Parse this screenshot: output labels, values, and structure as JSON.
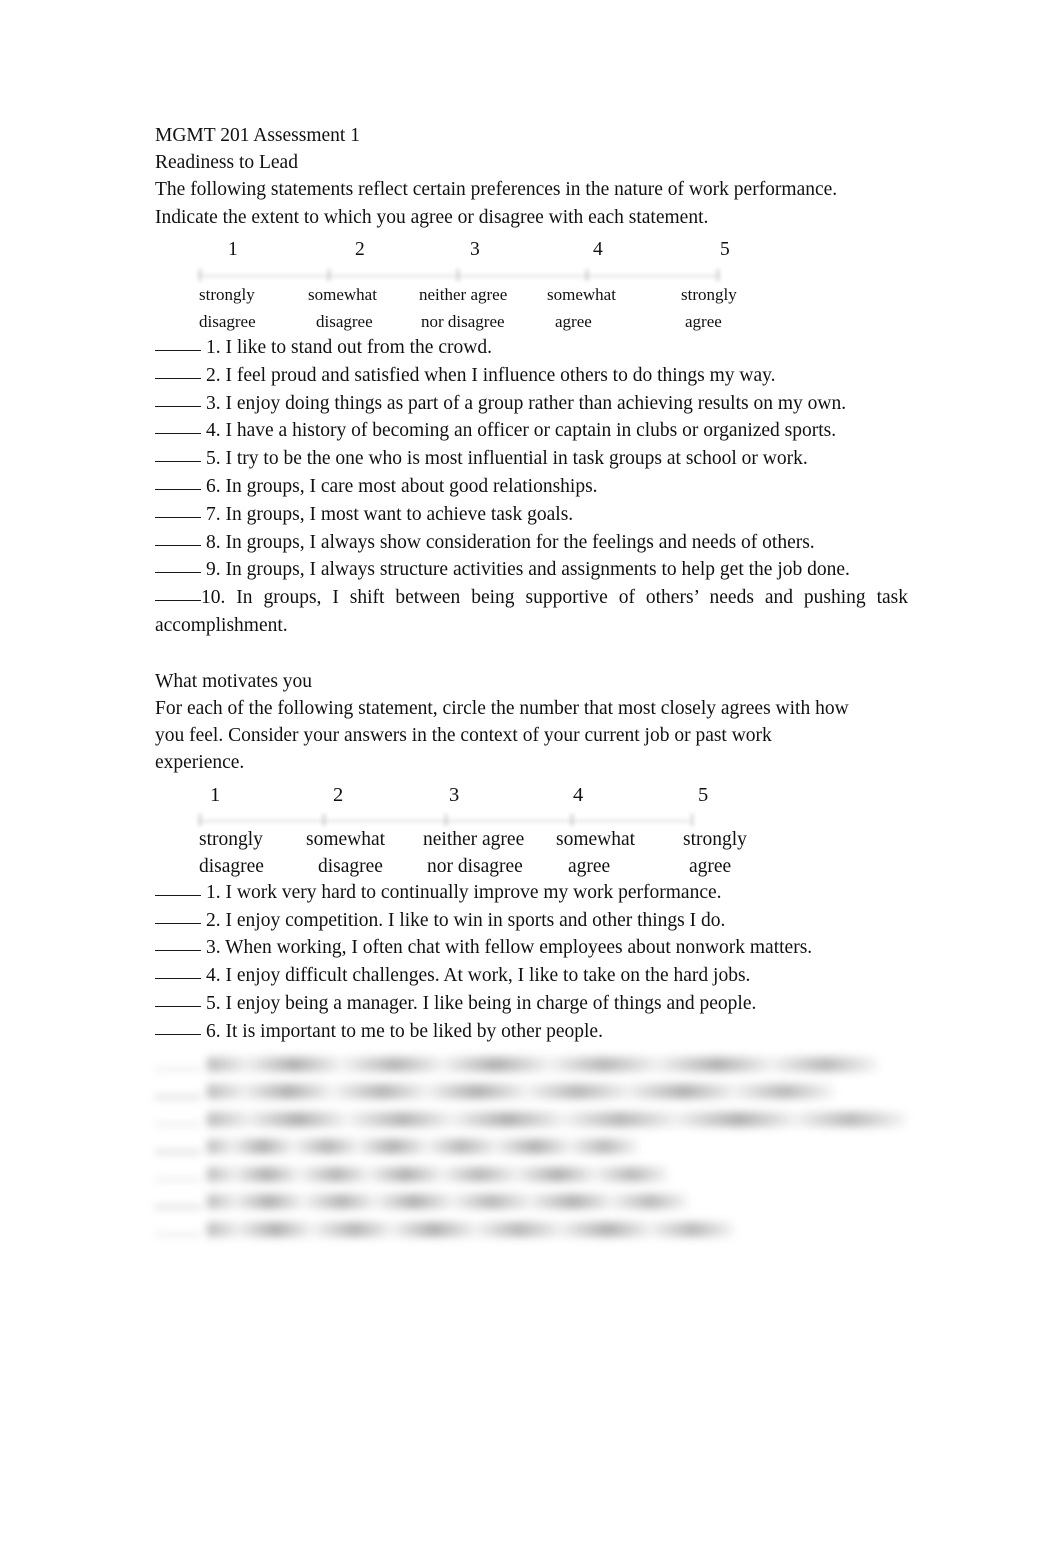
{
  "document": {
    "title": "MGMT 201 Assessment 1",
    "sections": [
      {
        "id": "readiness-to-lead",
        "heading": "Readiness to Lead",
        "instructions_line1": "The following statements reflect certain preferences in the nature of work performance.",
        "instructions_line2": "Indicate the extent to which you agree or disagree with each statement.",
        "scale": {
          "numbers": [
            "1",
            "2",
            "3",
            "4",
            "5"
          ],
          "labels": [
            {
              "line1": "strongly",
              "line2": "disagree"
            },
            {
              "line1": "somewhat",
              "line2": "disagree"
            },
            {
              "line1": "neither agree",
              "line2": "nor disagree"
            },
            {
              "line1": "somewhat",
              "line2": "agree"
            },
            {
              "line1": "strongly",
              "line2": "agree"
            }
          ]
        },
        "items": [
          "1. I like to stand out from the crowd.",
          "2. I feel proud and satisfied when I influence others to do things my way.",
          "3. I enjoy doing things as part of a group rather than achieving results on my own.",
          "4. I have a history of becoming an officer or captain in clubs or organized sports.",
          "5. I try to be the one who is most influential in task groups at school or work.",
          "6. In groups, I care most about good relationships.",
          "7. In groups, I most want to achieve task goals.",
          "8. In groups, I always show consideration for the feelings and needs of others.",
          "9. In groups, I always structure activities and assignments to help get the job done.",
          "10. In groups, I shift between being supportive of others’ needs and pushing task accomplishment."
        ]
      },
      {
        "id": "what-motivates-you",
        "heading": "What motivates you",
        "instructions_line1": "For each of the following statement, circle the number that most closely agrees with how",
        "instructions_line2": "you feel. Consider your answers in the context of your current job or past work",
        "instructions_line3": "experience.",
        "scale": {
          "numbers": [
            "1",
            "2",
            "3",
            "4",
            "5"
          ],
          "labels": [
            {
              "line1": "strongly",
              "line2": "disagree"
            },
            {
              "line1": "somewhat",
              "line2": "disagree"
            },
            {
              "line1": "neither agree",
              "line2": "nor disagree"
            },
            {
              "line1": "somewhat",
              "line2": "agree"
            },
            {
              "line1": "strongly",
              "line2": "agree"
            }
          ]
        },
        "items": [
          "1. I work very hard to continually improve my work performance.",
          "2. I enjoy competition. I like to win in sports and other things I do.",
          "3. When working, I often chat with fellow employees about nonwork matters.",
          "4. I enjoy difficult challenges. At work, I like to take on the hard jobs.",
          "5. I enjoy being a manager. I like being in charge of things and people.",
          "6. It is important to me to be liked by other people."
        ],
        "redacted_items_count": 7,
        "redacted_note": "illegible (blurred in source image)"
      }
    ]
  }
}
